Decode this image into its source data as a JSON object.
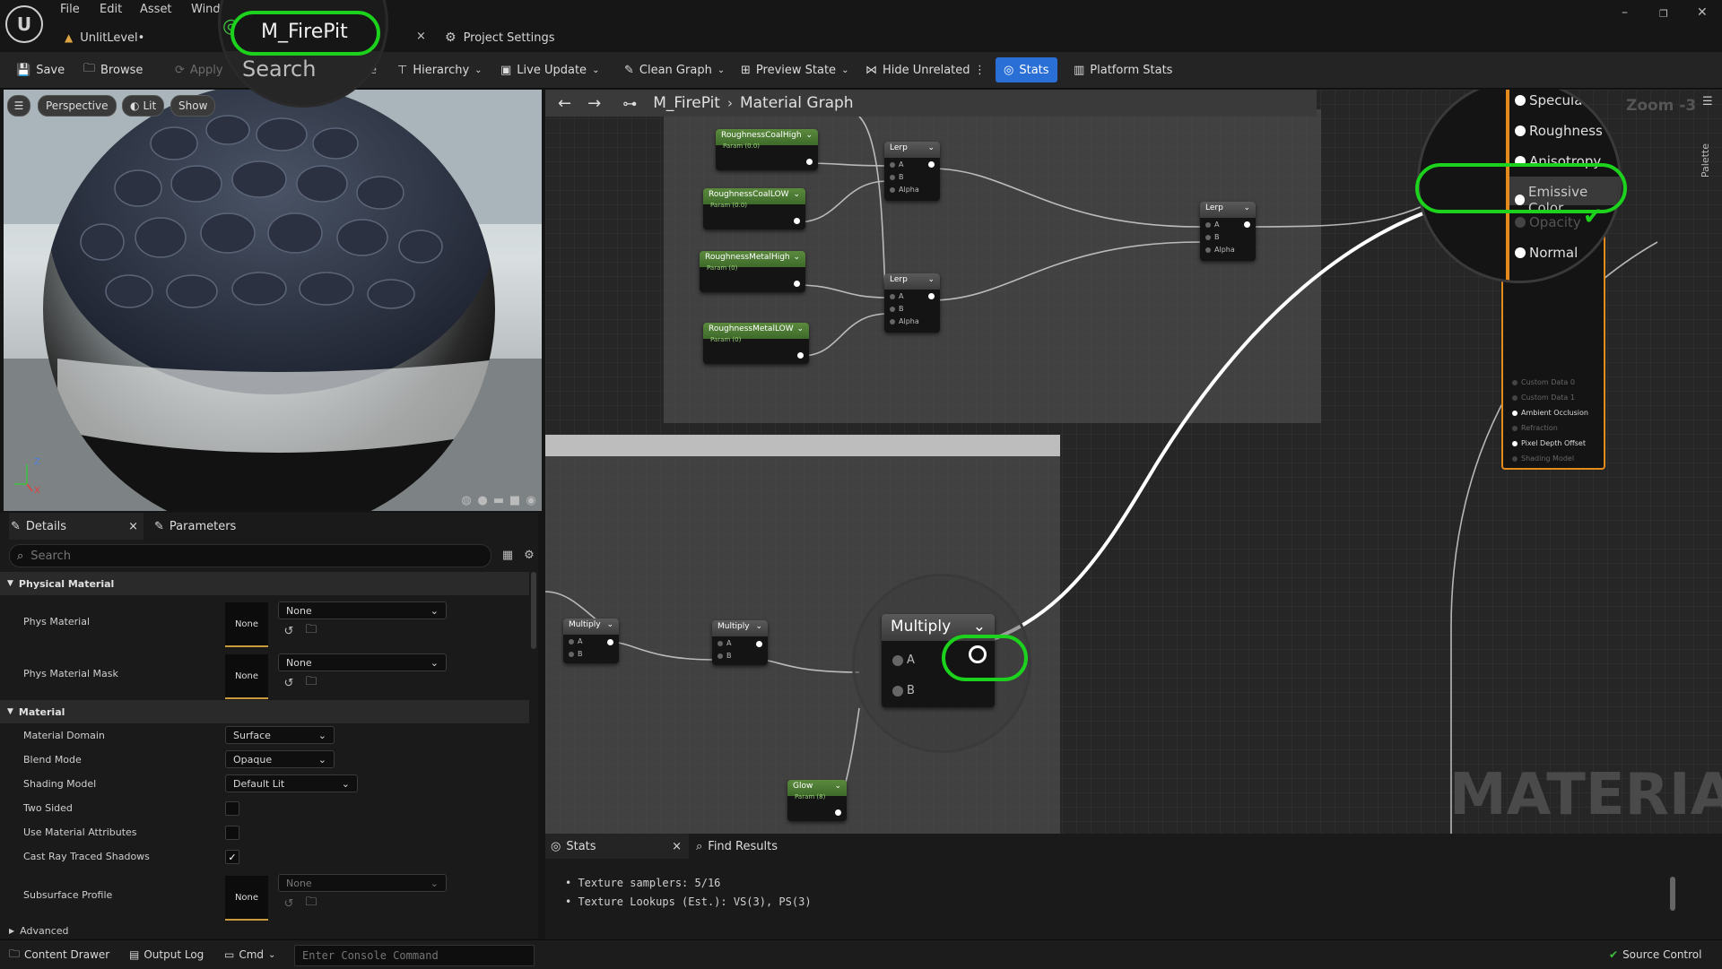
{
  "menu": {
    "file": "File",
    "edit": "Edit",
    "asset": "Asset",
    "window": "Windo"
  },
  "tabs": {
    "level": "UnlitLevel•",
    "material": "M_FirePit",
    "project_settings": "Project Settings"
  },
  "toolbar": {
    "save": "Save",
    "browse": "Browse",
    "apply": "Apply",
    "search": "Search",
    "partial": "e",
    "hierarchy": "Hierarchy",
    "live_update": "Live Update",
    "clean_graph": "Clean Graph",
    "preview_state": "Preview State",
    "hide_unrelated": "Hide Unrelated",
    "stats": "Stats",
    "platform_stats": "Platform Stats"
  },
  "viewport": {
    "perspective": "Perspective",
    "lit": "Lit",
    "show": "Show",
    "axis_z": "Z",
    "axis_x": "X"
  },
  "details": {
    "tab_details": "Details",
    "tab_parameters": "Parameters",
    "search_placeholder": "Search",
    "physical_material": "Physical Material",
    "phys_material": "Phys Material",
    "phys_material_value": "None",
    "phys_material_thumb": "None",
    "phys_material_mask": "Phys Material Mask",
    "phys_material_mask_value": "None",
    "phys_material_mask_thumb": "None",
    "material": "Material",
    "material_domain": "Material Domain",
    "material_domain_value": "Surface",
    "blend_mode": "Blend Mode",
    "blend_mode_value": "Opaque",
    "shading_model": "Shading Model",
    "shading_model_value": "Default Lit",
    "two_sided": "Two Sided",
    "use_material_attributes": "Use Material Attributes",
    "cast_ray_traced_shadows": "Cast Ray Traced Shadows",
    "subsurface_profile": "Subsurface Profile",
    "subsurface_profile_value": "None",
    "subsurface_profile_thumb": "None",
    "advanced": "Advanced",
    "checks": {
      "two_sided": false,
      "use_material_attributes": false,
      "cast_ray_traced_shadows": true
    }
  },
  "graph": {
    "crumb_material": "M_FirePit",
    "crumb_graph": "Material Graph",
    "zoom": "Zoom -3",
    "palette": "Palette",
    "watermark": "MATERIAL",
    "nodes": {
      "rough_coal_high": "RoughnessCoalHigh",
      "rough_coal_low": "RoughnessCoalLOW",
      "rough_metal_high": "RoughnessMetalHigh",
      "rough_metal_low": "RoughnessMetalLOW",
      "param_sub": "Param (0.0)",
      "param_sub2": "Param (0)",
      "lerp": "Lerp",
      "pin_a": "A",
      "pin_b": "B",
      "pin_alpha": "Alpha",
      "multiply": "Multiply",
      "glow": "Glow",
      "glow_sub": "Param (8)"
    },
    "result_pins": [
      "Custom Data 0",
      "Custom Data 1",
      "Ambient Occlusion",
      "Refraction",
      "Pixel Depth Offset",
      "Shading Model"
    ],
    "magnified_pins": [
      "Specular",
      "Roughness",
      "Anisotropy",
      "Emissive Color",
      "Opacity",
      "Normal"
    ]
  },
  "bottom": {
    "tab_stats": "Stats",
    "tab_find": "Find Results",
    "stat_lines": [
      "Texture samplers: 5/16",
      "Texture Lookups (Est.): VS(3), PS(3)"
    ]
  },
  "statusbar": {
    "content_drawer": "Content Drawer",
    "output_log": "Output Log",
    "cmd": "Cmd",
    "console_placeholder": "Enter Console Command",
    "source_control": "Source Control"
  },
  "colors": {
    "highlight": "#1cd21c",
    "accent": "#2a6fd6",
    "node_green": "#4c7a34"
  }
}
